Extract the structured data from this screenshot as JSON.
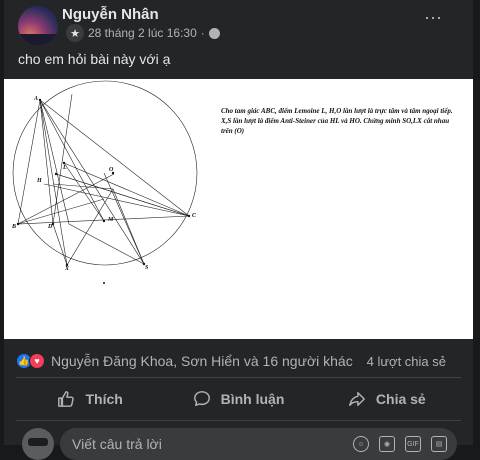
{
  "post": {
    "author": "Nguyễn Nhân",
    "timestamp": "28 tháng 2 lúc 16:30",
    "more_icon": "⋯",
    "text": "cho em hỏi bài này với ạ"
  },
  "figure": {
    "problem_text": "Cho tam giác ABC, điểm Lemoine L, H,O lần lượt là trực tâm và tâm ngoại tiếp. X,S lần lượt là điểm Anti-Steiner của HL và HO. Chứng minh SO,LX cắt nhau trên (O)",
    "labels": {
      "A": "A",
      "B": "B",
      "C": "C",
      "D": "D",
      "H": "H",
      "L": "L",
      "O": "O",
      "M": "M",
      "X": "X",
      "S": "S"
    }
  },
  "reactions": {
    "names": "Nguyễn Đăng Khoa, Sơn Hiển và 16 người khác",
    "shares": "4 lượt chia sẻ"
  },
  "actions": {
    "like": "Thích",
    "comment": "Bình luận",
    "share": "Chia sẻ"
  },
  "comment_input": {
    "placeholder": "Viết câu trả lời"
  },
  "colors": {
    "background": "#18191a",
    "card": "#242526",
    "text_primary": "#e4e6eb",
    "text_secondary": "#b0b3b8",
    "like_blue": "#1877f2",
    "love_red": "#f33e58"
  }
}
